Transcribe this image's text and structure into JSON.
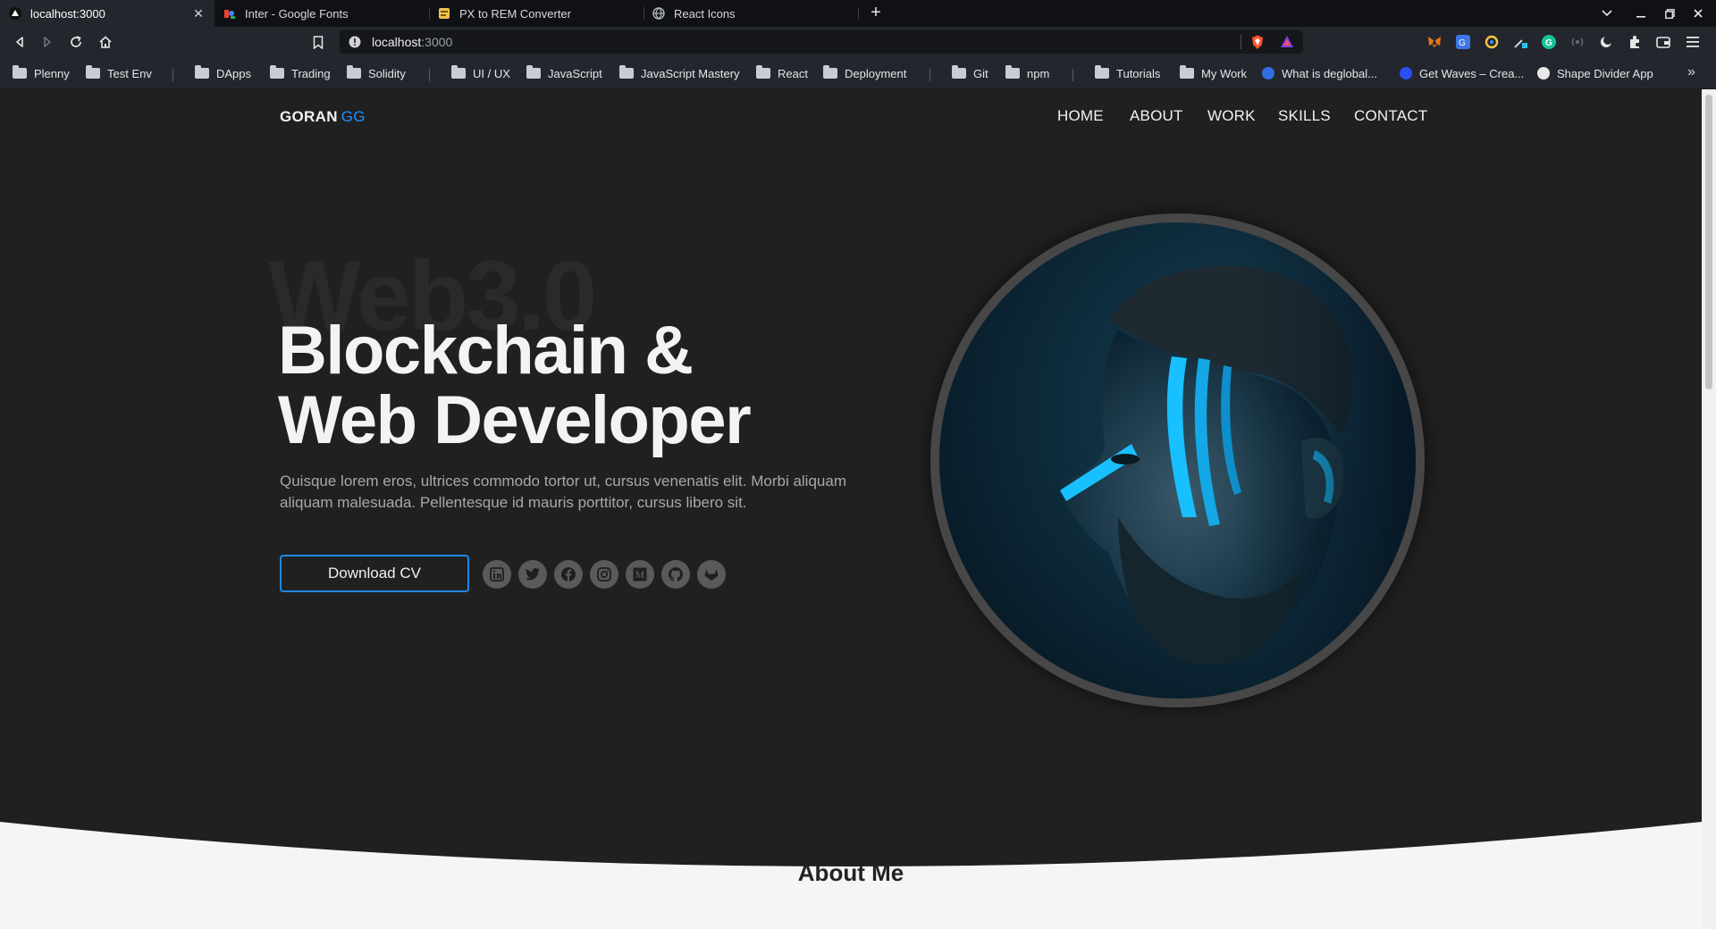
{
  "browser": {
    "tabs": [
      {
        "title": "localhost:3000",
        "active": true
      },
      {
        "title": "Inter - Google Fonts",
        "active": false
      },
      {
        "title": "PX to REM Converter",
        "active": false
      },
      {
        "title": "React Icons",
        "active": false
      }
    ],
    "url_host": "localhost",
    "url_port": ":3000",
    "bookmarks": [
      "Plenny",
      "Test Env",
      "DApps",
      "Trading",
      "Solidity",
      "UI / UX",
      "JavaScript",
      "JavaScript Mastery",
      "React",
      "Deployment",
      "Git",
      "npm",
      "Tutorials",
      "My Work",
      "What is deglobal...",
      "Get Waves – Crea...",
      "Shape Divider App"
    ]
  },
  "site": {
    "brand_main": "GORAN",
    "brand_accent": "GG",
    "nav": [
      "HOME",
      "ABOUT",
      "WORK",
      "SKILLS",
      "CONTACT"
    ],
    "hero": {
      "watermark": "Web3.0",
      "title_line1": "Blockchain &",
      "title_line2": "Web Developer",
      "description": "Quisque lorem eros, ultrices commodo tortor ut, cursus venenatis elit. Morbi aliquam aliquam malesuada. Pellentesque id mauris porttitor, cursus libero sit.",
      "cta_label": "Download CV",
      "social_icons": [
        "linkedin-icon",
        "twitter-icon",
        "facebook-icon",
        "instagram-icon",
        "medium-icon",
        "github-icon",
        "gitlab-icon"
      ]
    },
    "about_heading": "About Me"
  },
  "colors": {
    "accent": "#1e90ff",
    "hero_bg": "#202020",
    "section_bg": "#f5f5f5"
  }
}
